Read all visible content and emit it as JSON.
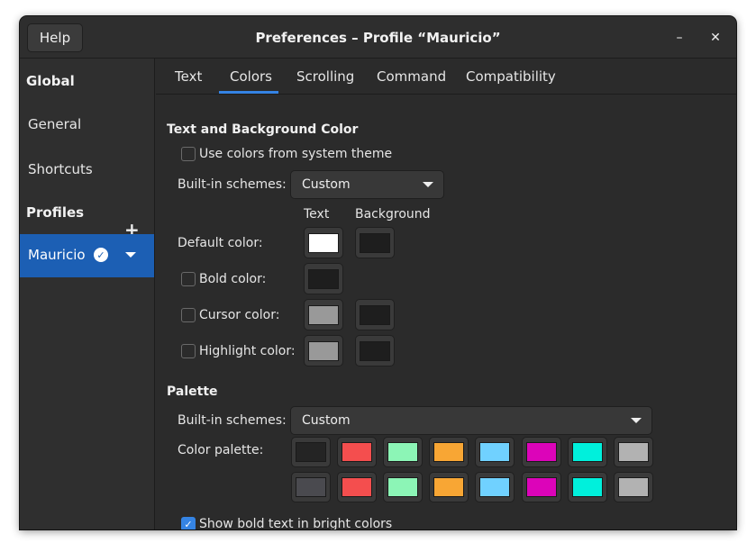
{
  "window": {
    "title": "Preferences – Profile “Mauricio”",
    "help_label": "Help",
    "minimize_glyph": "–",
    "close_glyph": "✕"
  },
  "sidebar": {
    "global_heading": "Global",
    "general": "General",
    "shortcuts": "Shortcuts",
    "profiles_heading": "Profiles",
    "add_glyph": "+",
    "selected_profile": "Mauricio",
    "default_check_glyph": "✓"
  },
  "tabs": [
    "Text",
    "Colors",
    "Scrolling",
    "Command",
    "Compatibility"
  ],
  "active_tab": "Colors",
  "text_bg": {
    "title": "Text and Background Color",
    "use_system_theme": "Use colors from system theme",
    "use_system_theme_checked": false,
    "builtin_label": "Built-in schemes:",
    "builtin_value": "Custom",
    "col_text": "Text",
    "col_background": "Background",
    "default_label": "Default color:",
    "bold_label": "Bold color:",
    "cursor_label": "Cursor color:",
    "highlight_label": "Highlight color:",
    "default_text_color": "#ffffff",
    "default_bg_color": "#1e1e1e",
    "bold_text_color": "#1e1e1e",
    "cursor_text_color": "#999999",
    "cursor_bg_color": "#1e1e1e",
    "highlight_text_color": "#999999",
    "highlight_bg_color": "#1e1e1e"
  },
  "palette": {
    "title": "Palette",
    "builtin_label": "Built-in schemes:",
    "builtin_value": "Custom",
    "palette_label": "Color palette:",
    "row1": [
      "#242424",
      "#f44e4e",
      "#8cf5b6",
      "#f8a634",
      "#70d1ff",
      "#dc04b9",
      "#00f0dc",
      "#b2b2b2"
    ],
    "row2": [
      "#4a4a4f",
      "#f44e4e",
      "#8cf5b6",
      "#f8a634",
      "#70d1ff",
      "#dc04b9",
      "#00f0dc",
      "#b2b2b2"
    ],
    "bold_bright": "Show bold text in bright colors",
    "bold_bright_checked": true
  },
  "accent_color": "#1c5fb4"
}
